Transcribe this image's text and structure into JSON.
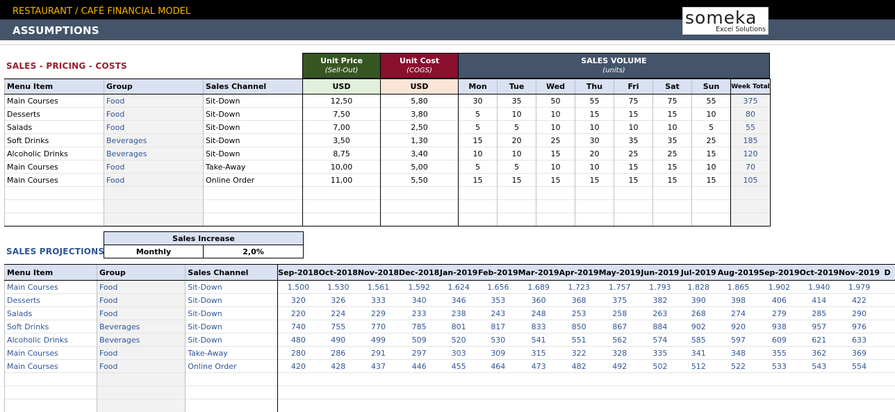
{
  "header": {
    "top_title": "RESTAURANT / CAFÉ FINANCIAL MODEL",
    "sub_title": "ASSUMPTIONS",
    "logo_main": "someka",
    "logo_sub": "Excel Solutions",
    "colors": {
      "top_bar": "#000000",
      "top_title": "#f5b400",
      "sub_bar": "#44546a"
    }
  },
  "pricing": {
    "section_title": "SALES - PRICING - COSTS",
    "unit_price": {
      "title": "Unit Price",
      "subtitle": "(Sell-Out)",
      "currency": "USD",
      "color": "#375623"
    },
    "unit_cost": {
      "title": "Unit Cost",
      "subtitle": "(COGS)",
      "currency": "USD",
      "color": "#8b0f2e"
    },
    "sales_volume": {
      "title": "SALES VOLUME",
      "subtitle": "(units)",
      "color": "#44546a"
    },
    "columns": {
      "menu_item": "Menu Item",
      "group": "Group",
      "sales_channel": "Sales Channel",
      "week_total": "Week Total"
    },
    "days": [
      "Mon",
      "Tue",
      "Wed",
      "Thu",
      "Fri",
      "Sat",
      "Sun"
    ],
    "rows": [
      {
        "item": "Main Courses",
        "group": "Food",
        "channel": "Sit-Down",
        "price": "12,50",
        "cost": "5,80",
        "volume": [
          "30",
          "35",
          "50",
          "55",
          "75",
          "75",
          "55"
        ],
        "total": "375"
      },
      {
        "item": "Desserts",
        "group": "Food",
        "channel": "Sit-Down",
        "price": "7,50",
        "cost": "3,80",
        "volume": [
          "5",
          "10",
          "10",
          "15",
          "15",
          "15",
          "10"
        ],
        "total": "80"
      },
      {
        "item": "Salads",
        "group": "Food",
        "channel": "Sit-Down",
        "price": "7,00",
        "cost": "2,50",
        "volume": [
          "5",
          "5",
          "10",
          "10",
          "10",
          "10",
          "5"
        ],
        "total": "55"
      },
      {
        "item": "Soft Drinks",
        "group": "Beverages",
        "channel": "Sit-Down",
        "price": "3,50",
        "cost": "1,30",
        "volume": [
          "15",
          "20",
          "25",
          "30",
          "35",
          "35",
          "25"
        ],
        "total": "185"
      },
      {
        "item": "Alcoholic Drinks",
        "group": "Beverages",
        "channel": "Sit-Down",
        "price": "8,75",
        "cost": "3,40",
        "volume": [
          "10",
          "10",
          "15",
          "20",
          "25",
          "25",
          "15"
        ],
        "total": "120"
      },
      {
        "item": "Main Courses",
        "group": "Food",
        "channel": "Take-Away",
        "price": "10,00",
        "cost": "5,00",
        "volume": [
          "5",
          "5",
          "10",
          "10",
          "15",
          "15",
          "10"
        ],
        "total": "70"
      },
      {
        "item": "Main Courses",
        "group": "Food",
        "channel": "Online Order",
        "price": "11,00",
        "cost": "5,50",
        "volume": [
          "15",
          "15",
          "15",
          "15",
          "15",
          "15",
          "15"
        ],
        "total": "105"
      }
    ],
    "empty_rows": 3
  },
  "projections": {
    "section_title": "SALES PROJECTIONS",
    "increase": {
      "title": "Sales Increase",
      "period": "Monthly",
      "value": "2,0%"
    },
    "columns": {
      "menu_item": "Menu Item",
      "group": "Group",
      "sales_channel": "Sales Channel"
    },
    "months": [
      "Sep-2018",
      "Oct-2018",
      "Nov-2018",
      "Dec-2018",
      "Jan-2019",
      "Feb-2019",
      "Mar-2019",
      "Apr-2019",
      "May-2019",
      "Jun-2019",
      "Jul-2019",
      "Aug-2019",
      "Sep-2019",
      "Oct-2019",
      "Nov-2019",
      "D"
    ],
    "rows": [
      {
        "item": "Main Courses",
        "group": "Food",
        "channel": "Sit-Down",
        "values": [
          "1.500",
          "1.530",
          "1.561",
          "1.592",
          "1.624",
          "1.656",
          "1.689",
          "1.723",
          "1.757",
          "1.793",
          "1.828",
          "1.865",
          "1.902",
          "1.940",
          "1.979",
          ""
        ]
      },
      {
        "item": "Desserts",
        "group": "Food",
        "channel": "Sit-Down",
        "values": [
          "320",
          "326",
          "333",
          "340",
          "346",
          "353",
          "360",
          "368",
          "375",
          "382",
          "390",
          "398",
          "406",
          "414",
          "422",
          ""
        ]
      },
      {
        "item": "Salads",
        "group": "Food",
        "channel": "Sit-Down",
        "values": [
          "220",
          "224",
          "229",
          "233",
          "238",
          "243",
          "248",
          "253",
          "258",
          "263",
          "268",
          "274",
          "279",
          "285",
          "290",
          ""
        ]
      },
      {
        "item": "Soft Drinks",
        "group": "Beverages",
        "channel": "Sit-Down",
        "values": [
          "740",
          "755",
          "770",
          "785",
          "801",
          "817",
          "833",
          "850",
          "867",
          "884",
          "902",
          "920",
          "938",
          "957",
          "976",
          ""
        ]
      },
      {
        "item": "Alcoholic Drinks",
        "group": "Beverages",
        "channel": "Sit-Down",
        "values": [
          "480",
          "490",
          "499",
          "509",
          "520",
          "530",
          "541",
          "551",
          "562",
          "574",
          "585",
          "597",
          "609",
          "621",
          "633",
          ""
        ]
      },
      {
        "item": "Main Courses",
        "group": "Food",
        "channel": "Take-Away",
        "values": [
          "280",
          "286",
          "291",
          "297",
          "303",
          "309",
          "315",
          "322",
          "328",
          "335",
          "341",
          "348",
          "355",
          "362",
          "369",
          ""
        ]
      },
      {
        "item": "Main Courses",
        "group": "Food",
        "channel": "Online Order",
        "values": [
          "420",
          "428",
          "437",
          "446",
          "455",
          "464",
          "473",
          "482",
          "492",
          "502",
          "512",
          "522",
          "533",
          "543",
          "554",
          ""
        ]
      }
    ],
    "empty_rows": 3
  }
}
